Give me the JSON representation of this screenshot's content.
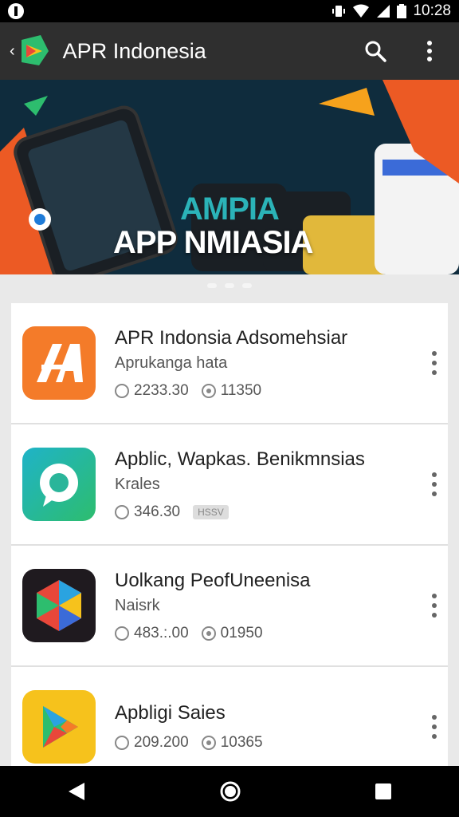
{
  "status_bar": {
    "time": "10:28"
  },
  "app_bar": {
    "title": "APR Indonesia"
  },
  "banner": {
    "title": "APP NMIASIA",
    "subtitle": "AMPIA"
  },
  "apps": [
    {
      "name": "APR Indonsia Adsomehsiar",
      "developer": "Aprukanga hata",
      "stat1": "2233.30",
      "stat2": "11350",
      "icon": "orange-a-icon"
    },
    {
      "name": "Apblic, Wapkas. Benikmnsias",
      "developer": "Krales",
      "stat1": "346.30",
      "badge": "HSSV",
      "icon": "chat-bubble-icon"
    },
    {
      "name": "Uolkang PeofUneenisa",
      "developer": "Naisrk",
      "stat1": "483.:.00",
      "stat2": "01950",
      "icon": "hexagon-icon"
    },
    {
      "name": "Apbligi Saies",
      "developer": "",
      "stat1": "209.200",
      "stat2": "10365",
      "icon": "play-store-icon"
    }
  ],
  "colors": {
    "app_bar": "#2f2f2f",
    "accent_orange": "#f47b29",
    "accent_green": "#2dbd6e",
    "play_yellow": "#f6c21c"
  }
}
